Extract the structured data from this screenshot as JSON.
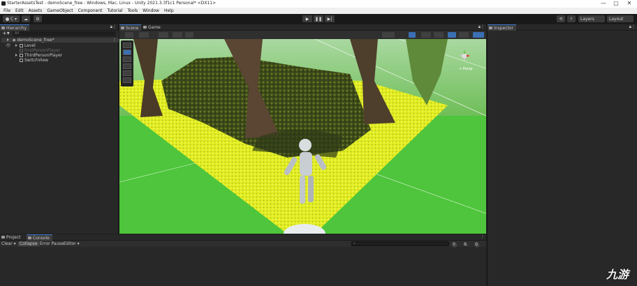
{
  "window": {
    "title": "StarterAssetsTest - demoScene_free - Windows, Mac, Linux - Unity 2021.3.3f1c1 Personal* <DX11>",
    "controls": [
      "—",
      "▢",
      "✕"
    ]
  },
  "menu": [
    "File",
    "Edit",
    "Assets",
    "GameObject",
    "Component",
    "Tutorial",
    "Tools",
    "Window",
    "Help"
  ],
  "toolbar": {
    "account": "C ▾",
    "layers": "Layers",
    "layout": "Layout"
  },
  "hierarchy": {
    "tab": "Hierarchy",
    "search_placeholder": "All",
    "scene": "demoScene_free*",
    "items": [
      {
        "label": "Level",
        "dim": false,
        "arrow": true
      },
      {
        "label": "FirstPersonPlayer",
        "dim": true,
        "arrow": false
      },
      {
        "label": "ThirdPersonPlayer",
        "dim": false,
        "arrow": true
      },
      {
        "label": "SwitchView",
        "dim": false,
        "arrow": false
      }
    ]
  },
  "scene": {
    "tabs": [
      "Scene",
      "Game"
    ],
    "persp": "< Persp"
  },
  "inspector": {
    "tab": "Inspector"
  },
  "console": {
    "tabs": [
      "Project",
      "Console"
    ],
    "tools": [
      "Clear ▾",
      "Collapse",
      "Error Pause",
      "Editor ▾"
    ],
    "counts": [
      "0",
      "0",
      "0"
    ]
  },
  "watermark": "九游",
  "colors": {
    "accent": "#3b6fb3",
    "grass": "#4ec53c",
    "path": "#e4f02a"
  }
}
